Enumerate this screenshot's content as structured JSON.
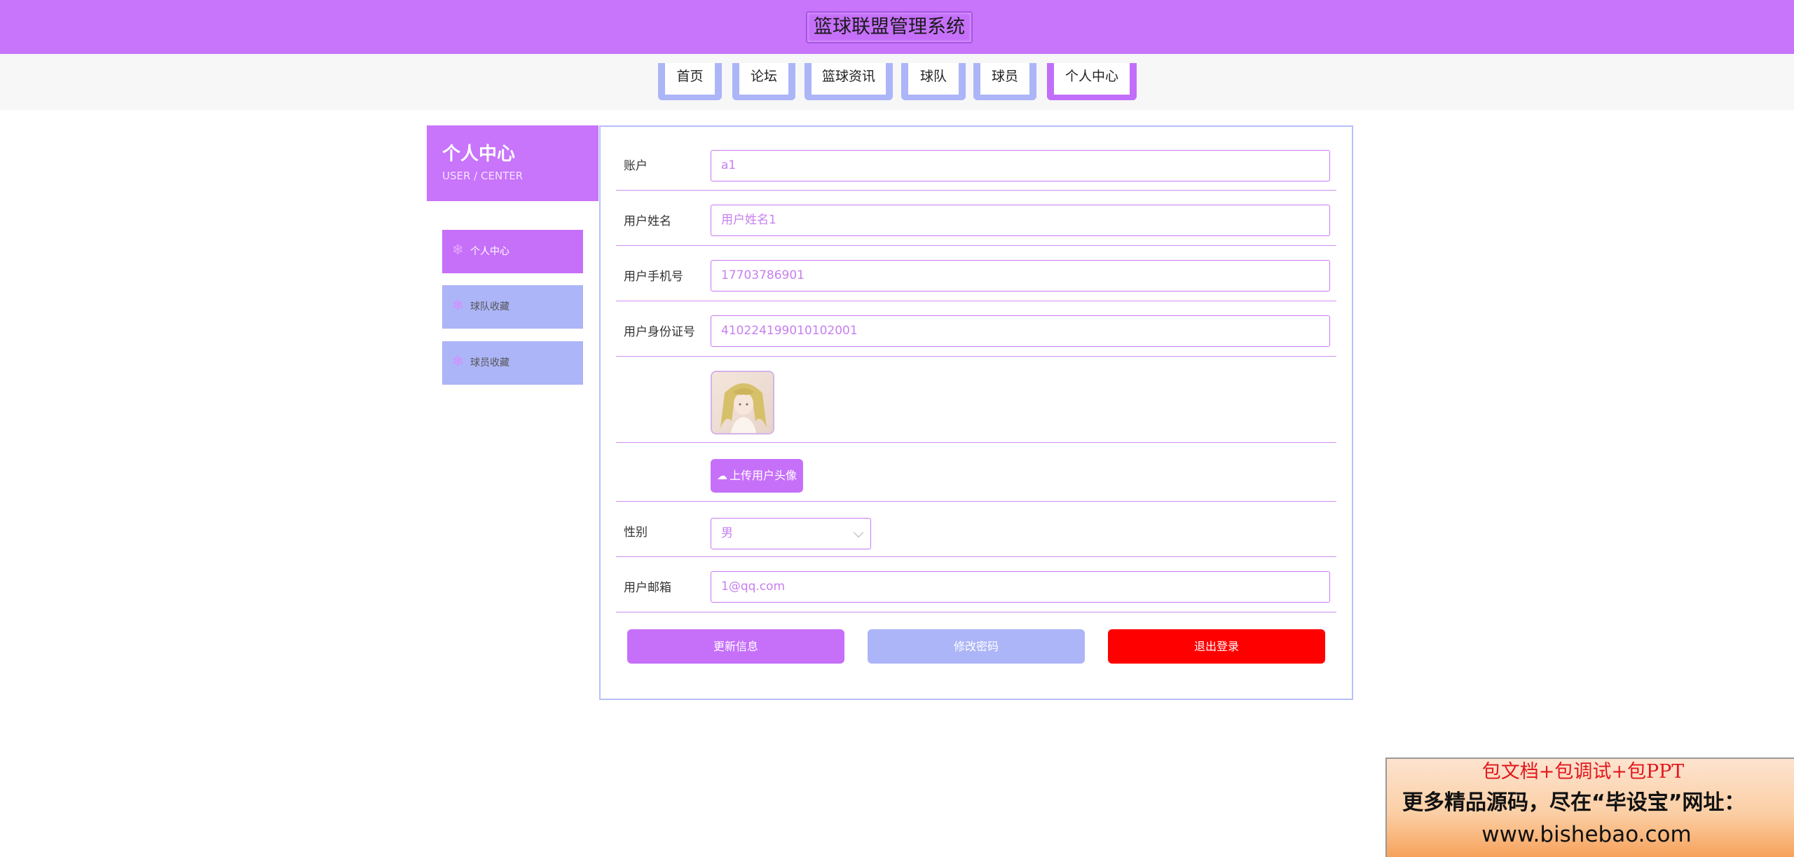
{
  "header": {
    "title": "篮球联盟管理系统"
  },
  "nav": {
    "items": [
      {
        "label": "首页"
      },
      {
        "label": "论坛"
      },
      {
        "label": "篮球资讯"
      },
      {
        "label": "球队"
      },
      {
        "label": "球员"
      },
      {
        "label": "个人中心",
        "active": true
      }
    ]
  },
  "sidebar": {
    "title": "个人中心",
    "subtitle": "USER / CENTER",
    "items": [
      {
        "label": "个人中心",
        "active": true
      },
      {
        "label": "球队收藏"
      },
      {
        "label": "球员收藏"
      }
    ]
  },
  "form": {
    "account": {
      "label": "账户",
      "value": "a1"
    },
    "name": {
      "label": "用户姓名",
      "value": "用户姓名1"
    },
    "phone": {
      "label": "用户手机号",
      "value": "17703786901"
    },
    "id_card": {
      "label": "用户身份证号",
      "value": "410224199010102001"
    },
    "upload_label": "上传用户头像",
    "gender": {
      "label": "性别",
      "value": "男"
    },
    "email": {
      "label": "用户邮箱",
      "value": "1@qq.com"
    }
  },
  "actions": {
    "update": "更新信息",
    "change_password": "修改密码",
    "logout": "退出登录"
  },
  "colors": {
    "primary": "#c874fb",
    "secondary": "#acb5f7",
    "danger": "#ff0000"
  },
  "promo": {
    "line1": "包文档+包调试+包PPT",
    "line2": "更多精品源码，尽在“毕设宝”网址：",
    "line3": "www.bishebao.com"
  }
}
